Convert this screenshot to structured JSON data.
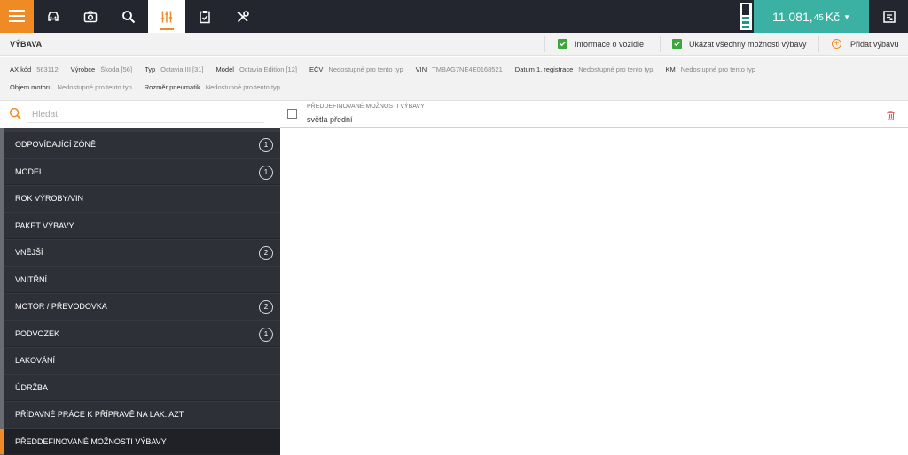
{
  "topbar": {
    "nav_icons": [
      "car-icon",
      "camera-icon",
      "search-icon",
      "sliders-icon",
      "clipboard-check-icon",
      "tools-icon"
    ],
    "active_icon": "sliders-icon",
    "price_main": "11.081,",
    "price_fraction": "45",
    "price_currency": "Kč",
    "accent_color": "#f08a24",
    "price_bg_color": "#3bb1a4"
  },
  "header": {
    "title": "VÝBAVA",
    "vehicle_info_label": "Informace o vozidle",
    "show_all_label": "Ukázat všechny možnosti výbavy",
    "add_label": "Přidat výbavu"
  },
  "vehicle": {
    "ax_code": {
      "label": "AX kód",
      "value": "563112"
    },
    "manufacturer": {
      "label": "Výrobce",
      "value": "Škoda [56]"
    },
    "type": {
      "label": "Typ",
      "value": "Octavia III [31]"
    },
    "model": {
      "label": "Model",
      "value": "Octavia Edition [12]"
    },
    "ecv": {
      "label": "EČV",
      "value": "Nedostupné pro tento typ"
    },
    "vin": {
      "label": "VIN",
      "value": "TMBAG7NE4E0168521"
    },
    "first_registration": {
      "label": "Datum 1. registrace",
      "value": "Nedostupné pro tento typ"
    },
    "km": {
      "label": "KM",
      "value": "Nedostupné pro tento typ"
    },
    "engine_volume": {
      "label": "Objem motoru",
      "value": "Nedostupné pro tento typ"
    },
    "tyre_size": {
      "label": "Rozměr pneumatik",
      "value": "Nedostupné pro tento typ"
    }
  },
  "search": {
    "placeholder": "Hledat"
  },
  "sidebar": {
    "items": [
      {
        "label": "ODPOVÍDAJÍCÍ ZÓNĚ",
        "badge": "1"
      },
      {
        "label": "MODEL",
        "badge": "1"
      },
      {
        "label": "ROK VÝROBY/VIN",
        "badge": ""
      },
      {
        "label": "PAKET VÝBAVY",
        "badge": ""
      },
      {
        "label": "VNĚJŠÍ",
        "badge": "2"
      },
      {
        "label": "VNITŘNÍ",
        "badge": ""
      },
      {
        "label": "MOTOR / PŘEVODOVKA",
        "badge": "2"
      },
      {
        "label": "PODVOZEK",
        "badge": "1"
      },
      {
        "label": "LAKOVÁNÍ",
        "badge": ""
      },
      {
        "label": "ÚDRŽBA",
        "badge": ""
      },
      {
        "label": "PŘÍDAVNÉ PRÁCE K PŘÍPRAVĚ NA LAK. AZT",
        "badge": ""
      },
      {
        "label": "PŘEDDEFINOVANÉ MOŽNOSTI VÝBAVY",
        "badge": ""
      }
    ],
    "active_index": 11
  },
  "main": {
    "rows": [
      {
        "category": "PŘEDDEFINOVANÉ MOŽNOSTI VÝBAVY",
        "name": "světla přední"
      }
    ]
  }
}
